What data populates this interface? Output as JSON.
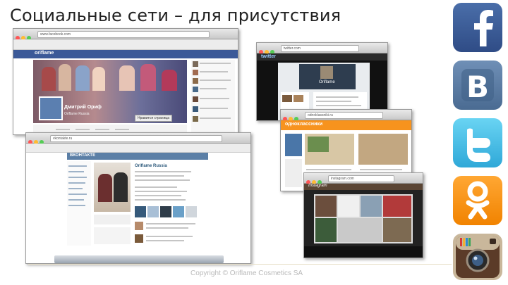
{
  "slide": {
    "title": "Социальные сети – для присутствия",
    "footer": "Copyright © Oriflame Cosmetics SA"
  },
  "screens": {
    "facebook": {
      "url": "www.facebook.com",
      "brand": "oriflame",
      "profile_name": "Дмитрий Ориф",
      "profile_sub": "Oriflame Russia",
      "button_label": "Нравится страница"
    },
    "vkontakte": {
      "url": "vkontakte.ru",
      "brand": "ВКОНТАКТЕ",
      "group_title": "Oriflame Russia"
    },
    "twitter": {
      "url": "twitter.com",
      "brand": "twitter",
      "profile_name": "Oriflame"
    },
    "odnoklassniki": {
      "url": "odnoklassniki.ru",
      "brand": "одноклассники"
    },
    "instagram": {
      "url": "instagram.com",
      "brand": "Instagram"
    }
  },
  "logos": [
    {
      "name": "facebook",
      "icon": "facebook-f-icon",
      "color": "#3b5998"
    },
    {
      "name": "vkontakte",
      "icon": "vk-b-icon",
      "color": "#5b7fa6"
    },
    {
      "name": "twitter",
      "icon": "twitter-bird-icon",
      "color": "#33b5e5"
    },
    {
      "name": "odnoklassniki",
      "icon": "ok-person-icon",
      "color": "#f7931e"
    },
    {
      "name": "instagram",
      "icon": "instagram-camera-icon",
      "color": "#8a6d4b"
    }
  ]
}
